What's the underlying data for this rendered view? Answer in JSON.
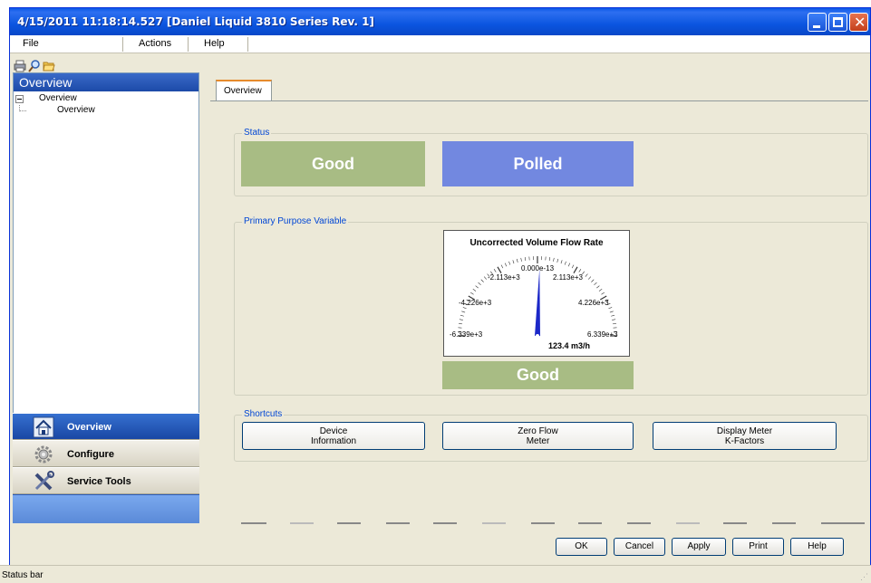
{
  "window": {
    "title": "4/15/2011 11:18:14.527 [Daniel Liquid 3810 Series Rev. 1]"
  },
  "menu": {
    "file": "File",
    "actions": "Actions",
    "help": "Help"
  },
  "toolbar": {
    "icons": [
      "print-icon",
      "find-icon",
      "open-folder-icon"
    ]
  },
  "left_panel": {
    "header": "Overview",
    "tree": {
      "root": "Overview",
      "child": "Overview"
    },
    "nav": [
      {
        "label": "Overview",
        "icon": "home-icon",
        "active": true
      },
      {
        "label": "Configure",
        "icon": "gear-icon",
        "active": false
      },
      {
        "label": "Service Tools",
        "icon": "tools-icon",
        "active": false
      }
    ]
  },
  "tabs": [
    {
      "label": "Overview"
    }
  ],
  "status_group": {
    "title": "Status",
    "status_value": "Good",
    "mode_value": "Polled",
    "status_color": "#a8bc84",
    "mode_color": "#7288e0"
  },
  "ppv_group": {
    "title": "Primary Purpose Variable",
    "gauge": {
      "title": "Uncorrected Volume Flow Rate",
      "value": 123.4,
      "value_text": "123.4 m3/h",
      "min": -6339,
      "max": 6339,
      "tick_labels": {
        "center": "0.000e-13",
        "inner_left": "-2.113e+3",
        "inner_right": "2.113e+3",
        "mid_left": "-4.226e+3",
        "mid_right": "4.226e+3",
        "low_left": "-6.339e+3",
        "low_right": "6.339e+3"
      },
      "needle_color": "#1c28c8"
    },
    "quality": "Good",
    "quality_color": "#a8bc84"
  },
  "shortcuts": {
    "title": "Shortcuts",
    "device_information": [
      "Device",
      "Information"
    ],
    "zero_flow": [
      "Zero Flow",
      "Meter"
    ],
    "display_meter": [
      "Display Meter",
      "K-Factors"
    ]
  },
  "dialog_buttons": {
    "ok": "OK",
    "cancel": "Cancel",
    "apply": "Apply",
    "print": "Print",
    "help": "Help"
  },
  "statusbar": {
    "text": "Status bar"
  }
}
